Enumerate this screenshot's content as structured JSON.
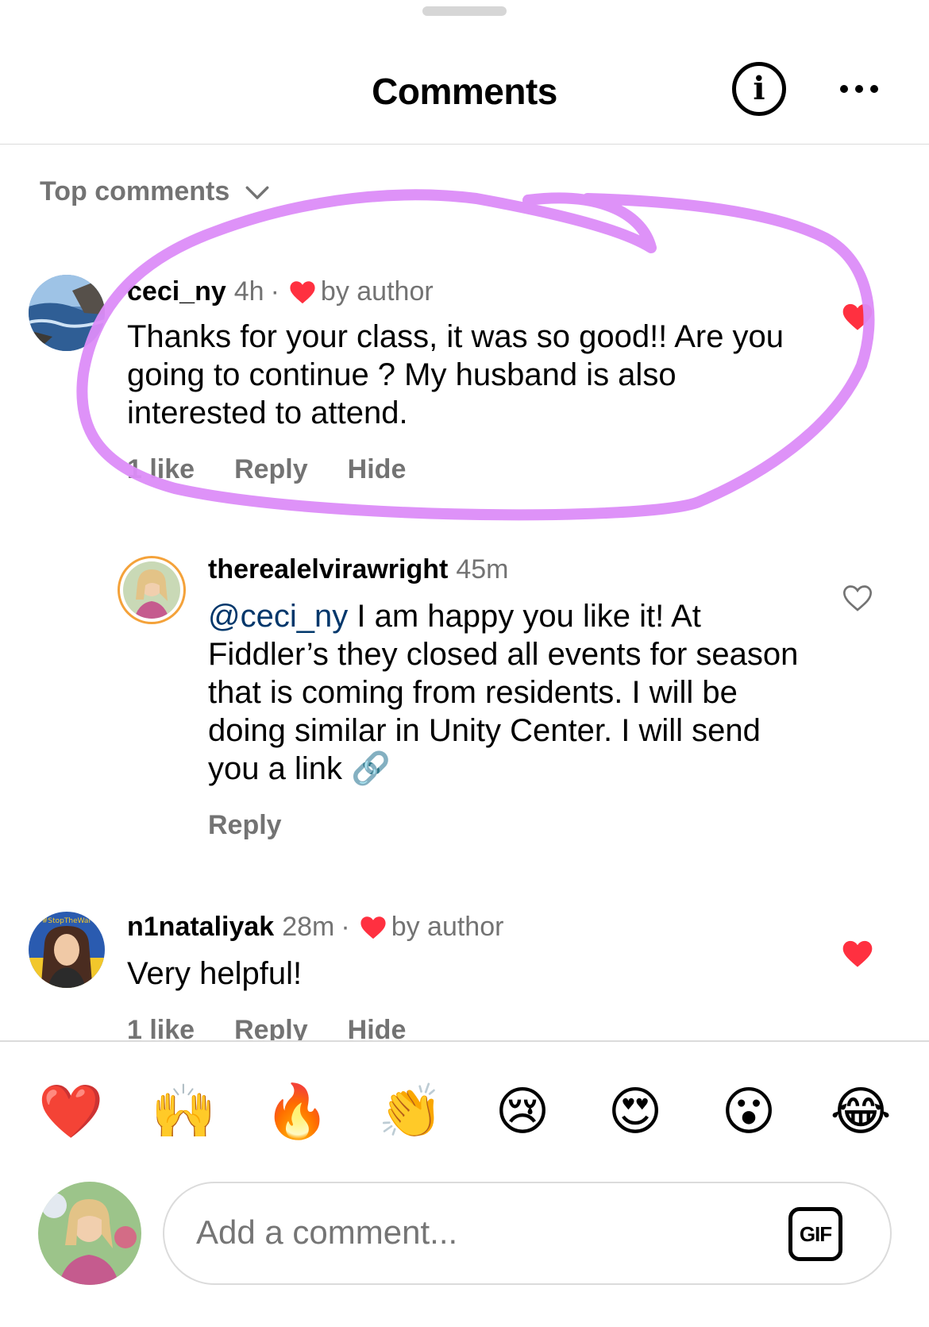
{
  "header": {
    "title": "Comments"
  },
  "sort": {
    "label": "Top comments"
  },
  "comments": [
    {
      "username": "ceci_ny",
      "time": "4h",
      "separator": "·",
      "author_badge": "by author",
      "text": "Thanks for your class, it was so good!! Are you going to continue ? My husband is also interested to attend.",
      "likes": "1 like",
      "reply_label": "Reply",
      "hide_label": "Hide",
      "liked": true
    },
    {
      "username": "therealelvirawright",
      "time": "45m",
      "mention": "@ceci_ny",
      "text": " I am happy you like it! At Fiddler’s they closed all events for season that is coming from residents. I will be doing similar in Unity Center. I will send you a link 🔗",
      "reply_label": "Reply",
      "liked": false
    },
    {
      "username": "n1nataliyak",
      "time": "28m",
      "separator": "·",
      "author_badge": "by author",
      "text": "Very helpful!",
      "likes": "1 like",
      "reply_label": "Reply",
      "hide_label": "Hide",
      "liked": true,
      "avatar_banner": "#StopTheWar"
    }
  ],
  "emoji_bar": [
    "❤️",
    "🙌",
    "🔥",
    "👏",
    "😢",
    "😍",
    "😮",
    "😂"
  ],
  "composer": {
    "placeholder": "Add a comment...",
    "gif_label": "GIF"
  },
  "colors": {
    "like_red": "#ff3040",
    "secondary_text": "#737373",
    "mention_blue": "#00376b",
    "annotation_purple": "#dc8cf8"
  }
}
